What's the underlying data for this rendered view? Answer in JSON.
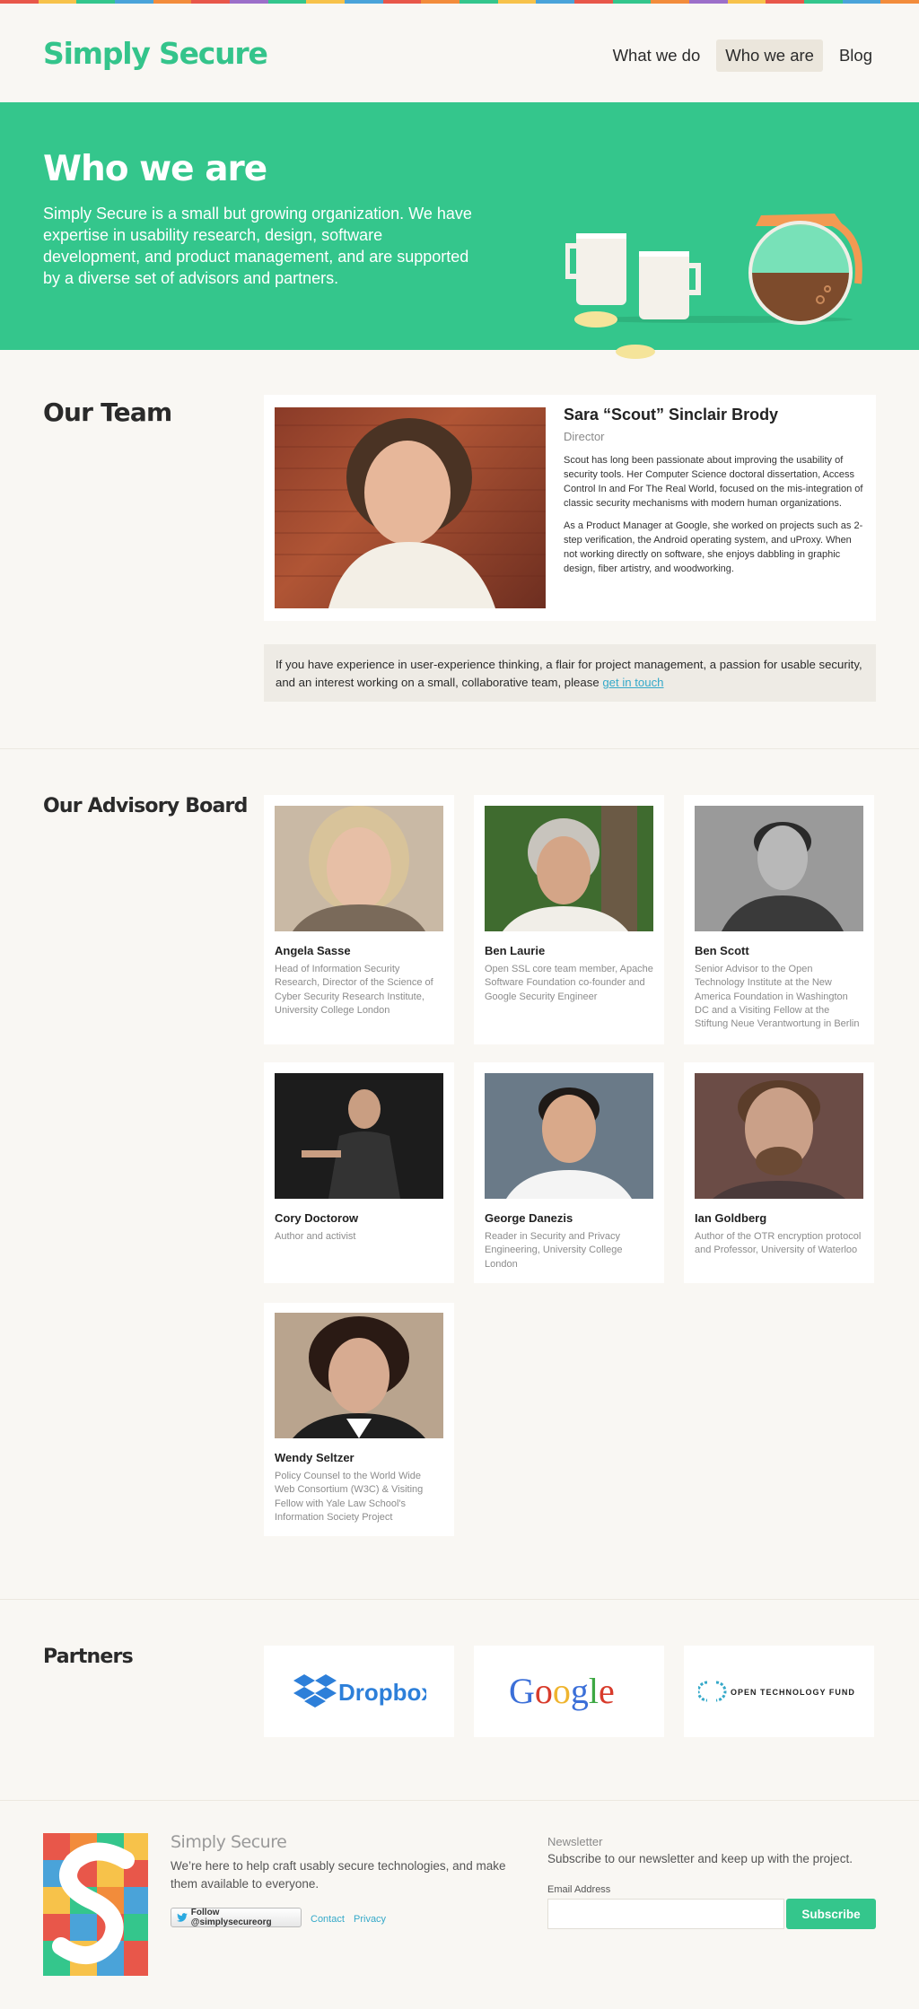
{
  "header": {
    "logo": "Simply Secure",
    "nav": [
      {
        "label": "What we do"
      },
      {
        "label": "Who we are",
        "active": true
      },
      {
        "label": "Blog"
      }
    ]
  },
  "hero": {
    "title": "Who we are",
    "text": "Simply Secure is a small but growing organization. We have expertise in usability research, design, software development, and product management, and are supported by a diverse set of advisors and partners."
  },
  "team": {
    "title": "Our Team",
    "director": {
      "name": "Sara “Scout” Sinclair Brody",
      "role": "Director",
      "bio": [
        "Scout has long been passionate about improving the usability of security tools. Her Computer Science doctoral dissertation, Access Control In and For The Real World, focused on the mis-integration of classic security mechanisms with modern human organizations.",
        "As a Product Manager at Google, she worked on projects such as 2-step verification, the Android operating system, and uProxy. When not working directly on software, she enjoys dabbling in graphic design, fiber artistry, and woodworking."
      ]
    },
    "note": {
      "text": "If you have experience in user-experience thinking, a flair for project management, a passion for usable security, and an interest working on a small, collaborative team, please ",
      "link": "get in touch"
    }
  },
  "advisory": {
    "title": "Our Advisory Board",
    "members": [
      {
        "name": "Angela Sasse",
        "role": "Head of Information Security Research, Director of the Science of Cyber Security Research Institute, University College London"
      },
      {
        "name": "Ben Laurie",
        "role": "Open SSL core team member, Apache Software Foundation co-founder and Google Security Engineer"
      },
      {
        "name": "Ben Scott",
        "role": "Senior Advisor to the Open Technology Institute at the New America Foundation in Washington DC and a Visiting Fellow at the Stiftung Neue Verantwortung in Berlin"
      },
      {
        "name": "Cory Doctorow",
        "role": "Author and activist"
      },
      {
        "name": "George Danezis",
        "role": "Reader in Security and Privacy Engineering, University College London"
      },
      {
        "name": "Ian Goldberg",
        "role": "Author of the OTR encryption protocol and Professor, University of Waterloo"
      },
      {
        "name": "Wendy Seltzer",
        "role": "Policy Counsel to the World Wide Web Consortium (W3C) & Visiting Fellow with Yale Law School's Information Society Project"
      }
    ]
  },
  "partners": {
    "title": "Partners",
    "items": [
      {
        "name": "Dropbox"
      },
      {
        "name": "Google"
      },
      {
        "name": "OPEN TECHNOLOGY FUND"
      }
    ]
  },
  "footer": {
    "brand": "Simply Secure",
    "tagline": "We’re here to help craft usably secure technologies, and make them available to everyone.",
    "twitter": "Follow @simplysecureorg",
    "links": [
      "Contact",
      "Privacy"
    ],
    "newsletter": {
      "title": "Newsletter",
      "desc": "Subscribe to our newsletter and keep up with the project.",
      "label": "Email Address",
      "placeholder": "",
      "button": "Subscribe"
    }
  },
  "colors": {
    "brand": "#34c68c",
    "link": "#35a9c9"
  }
}
